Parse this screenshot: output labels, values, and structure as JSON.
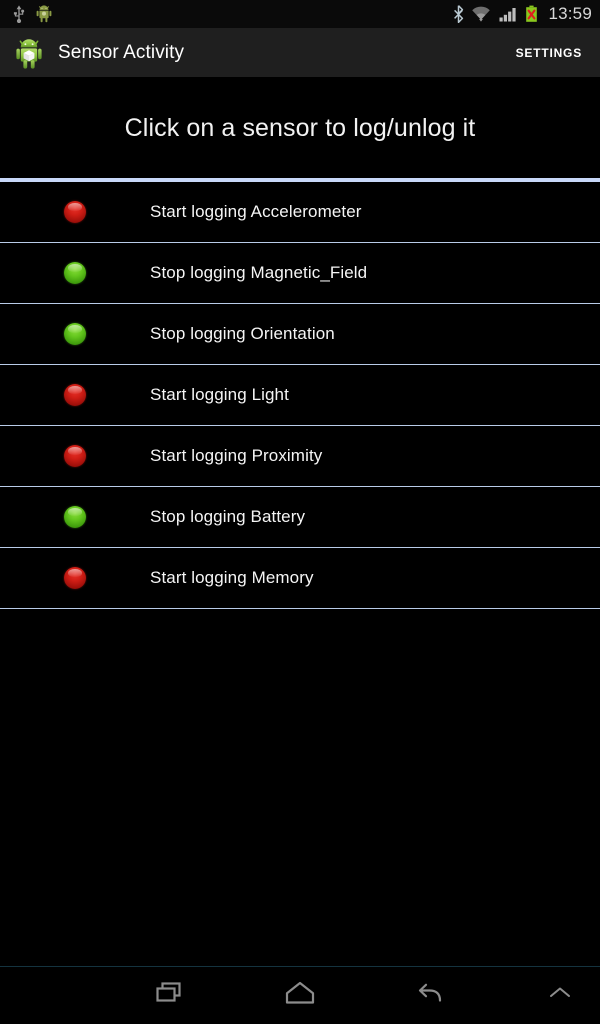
{
  "status_bar": {
    "left_icons": [
      {
        "name": "usb-icon",
        "label": "USB connected"
      },
      {
        "name": "android-debug-icon",
        "label": "USB debugging connected"
      }
    ],
    "right_icons": [
      {
        "name": "bluetooth-icon",
        "label": "Bluetooth on"
      },
      {
        "name": "wifi-icon",
        "label": "Wi-Fi connected"
      },
      {
        "name": "cellular-signal-icon",
        "label": "Cellular signal"
      },
      {
        "name": "battery-icon",
        "label": "Battery unknown"
      }
    ],
    "time": "13:59",
    "accent_colors": {
      "battery_fill": "#8ac81e",
      "battery_error": "#e02020",
      "icon_grey": "#9a9a9a",
      "time_text": "#d8d8d8"
    }
  },
  "action_bar": {
    "app_icon": "android-robot-icon",
    "title": "Sensor Activity",
    "settings_label": "SETTINGS",
    "background": "#1f1f1f"
  },
  "main": {
    "instruction": "Click on a sensor to log/unlog it",
    "divider_color": "#c8d8f8",
    "row_divider_color": "#b9cbe8",
    "led_colors": {
      "on": "#63c61d",
      "off": "#cf1d15"
    },
    "sensors": [
      {
        "label": "Start logging Accelerometer",
        "state": "off",
        "led": "led-indicator-red",
        "sensor": "Accelerometer"
      },
      {
        "label": "Stop logging Magnetic_Field",
        "state": "on",
        "led": "led-indicator-green",
        "sensor": "Magnetic_Field"
      },
      {
        "label": "Stop logging Orientation",
        "state": "on",
        "led": "led-indicator-green",
        "sensor": "Orientation"
      },
      {
        "label": "Start logging Light",
        "state": "off",
        "led": "led-indicator-red",
        "sensor": "Light"
      },
      {
        "label": "Start logging Proximity",
        "state": "off",
        "led": "led-indicator-red",
        "sensor": "Proximity"
      },
      {
        "label": "Stop logging Battery",
        "state": "on",
        "led": "led-indicator-green",
        "sensor": "Battery"
      },
      {
        "label": "Start logging Memory",
        "state": "off",
        "led": "led-indicator-red",
        "sensor": "Memory"
      }
    ]
  },
  "nav_bar": {
    "buttons": [
      {
        "name": "recents-button",
        "icon": "recents-icon",
        "label": "Recent apps"
      },
      {
        "name": "home-button",
        "icon": "home-icon",
        "label": "Home"
      },
      {
        "name": "back-button",
        "icon": "back-icon",
        "label": "Back"
      },
      {
        "name": "expand-button",
        "icon": "chevron-up-icon",
        "label": "Expand"
      }
    ],
    "icon_color": "#8c8c8c"
  }
}
